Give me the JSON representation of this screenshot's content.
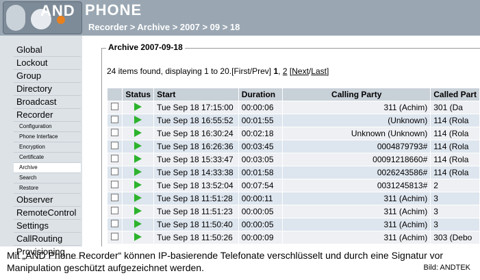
{
  "app": {
    "logo_text": "AND",
    "title": "PHONE"
  },
  "breadcrumb": "Recorder > Archive > 2007 > 09 > 18",
  "sidebar": {
    "items": [
      {
        "label": "Global",
        "sub": false
      },
      {
        "label": "Lockout",
        "sub": false
      },
      {
        "label": "Group",
        "sub": false
      },
      {
        "label": "Directory",
        "sub": false
      },
      {
        "label": "Broadcast",
        "sub": false
      },
      {
        "label": "Recorder",
        "sub": false
      },
      {
        "label": "Configuration",
        "sub": true
      },
      {
        "label": "Phone Interface",
        "sub": true
      },
      {
        "label": "Encryption",
        "sub": true
      },
      {
        "label": "Certificate",
        "sub": true
      },
      {
        "label": "Archive",
        "sub": true,
        "active": true
      },
      {
        "label": "Search",
        "sub": true
      },
      {
        "label": "Restore",
        "sub": true
      },
      {
        "label": "Observer",
        "sub": false
      },
      {
        "label": "RemoteControl",
        "sub": false
      },
      {
        "label": "Settings",
        "sub": false
      },
      {
        "label": "CallRouting",
        "sub": false
      },
      {
        "label": "Provisioning",
        "sub": false
      }
    ]
  },
  "archive": {
    "legend": "Archive 2007-09-18",
    "found_text": "24 items found, displaying 1 to 20.",
    "first_prev": "[First/Prev]",
    "page1": "1",
    "sep": ",",
    "page2": "2",
    "next_last_open": "[",
    "next_label": "Next",
    "slash": "/",
    "last_label": "Last",
    "next_last_close": "]",
    "columns": [
      "Status",
      "Start",
      "Duration",
      "Calling Party",
      "Called Part"
    ],
    "rows": [
      {
        "start": "Tue Sep 18  17:15:00",
        "duration": "00:00:06",
        "calling": "311 (Achim)",
        "called": "301 (Da"
      },
      {
        "start": "Tue Sep 18  16:55:52",
        "duration": "00:01:55",
        "calling": "(Unknown)",
        "called": "114 (Rola"
      },
      {
        "start": "Tue Sep 18  16:30:24",
        "duration": "00:02:18",
        "calling": "Unknown (Unknown)",
        "called": "114 (Rola"
      },
      {
        "start": "Tue Sep 18  16:26:36",
        "duration": "00:03:45",
        "calling": "0004879793#",
        "called": "114 (Rola"
      },
      {
        "start": "Tue Sep 18  15:33:47",
        "duration": "00:03:05",
        "calling": "00091218660#",
        "called": "114 (Rola"
      },
      {
        "start": "Tue Sep 18  14:33:38",
        "duration": "00:01:58",
        "calling": "0026243586#",
        "called": "114 (Rola"
      },
      {
        "start": "Tue Sep 18  13:52:04",
        "duration": "00:07:54",
        "calling": "0031245813#",
        "called": "2"
      },
      {
        "start": "Tue Sep 18  11:51:28",
        "duration": "00:00:11",
        "calling": "311 (Achim)",
        "called": "3"
      },
      {
        "start": "Tue Sep 18  11:51:23",
        "duration": "00:00:05",
        "calling": "311 (Achim)",
        "called": "3"
      },
      {
        "start": "Tue Sep 18  11:50:40",
        "duration": "00:00:05",
        "calling": "311 (Achim)",
        "called": "3"
      },
      {
        "start": "Tue Sep 18  11:50:26",
        "duration": "00:00:09",
        "calling": "311 (Achim)",
        "called": "303 (Debo"
      }
    ]
  },
  "caption": "Mit „AND Phone Recorder“ können IP-basierende Telefonate verschlüsselt und durch eine Signatur vor Manipulation geschützt aufgezeichnet werden.",
  "credit": "Bild: ANDTEK"
}
